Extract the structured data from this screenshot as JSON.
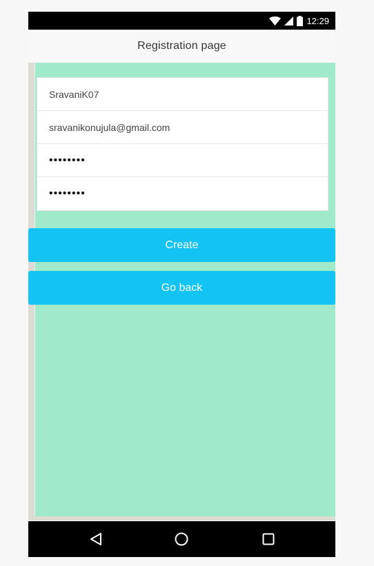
{
  "status_bar": {
    "time": "12:29",
    "icons": [
      "wifi-icon",
      "signal-icon",
      "battery-icon"
    ]
  },
  "app_bar": {
    "title": "Registration page"
  },
  "form": {
    "username_value": "SravaniK07",
    "email_value": "sravanikonujula@gmail.com",
    "password_value": "12345678",
    "confirm_password_value": "12345678"
  },
  "buttons": {
    "create_label": "Create",
    "go_back_label": "Go back"
  },
  "nav_bar": {
    "icons": [
      "back-triangle-icon",
      "home-circle-icon",
      "recents-square-icon"
    ]
  },
  "colors": {
    "content_bg": "#a0e9cb",
    "button_bg": "#12c3f4",
    "app_bar_bg": "#f8f8f8"
  }
}
